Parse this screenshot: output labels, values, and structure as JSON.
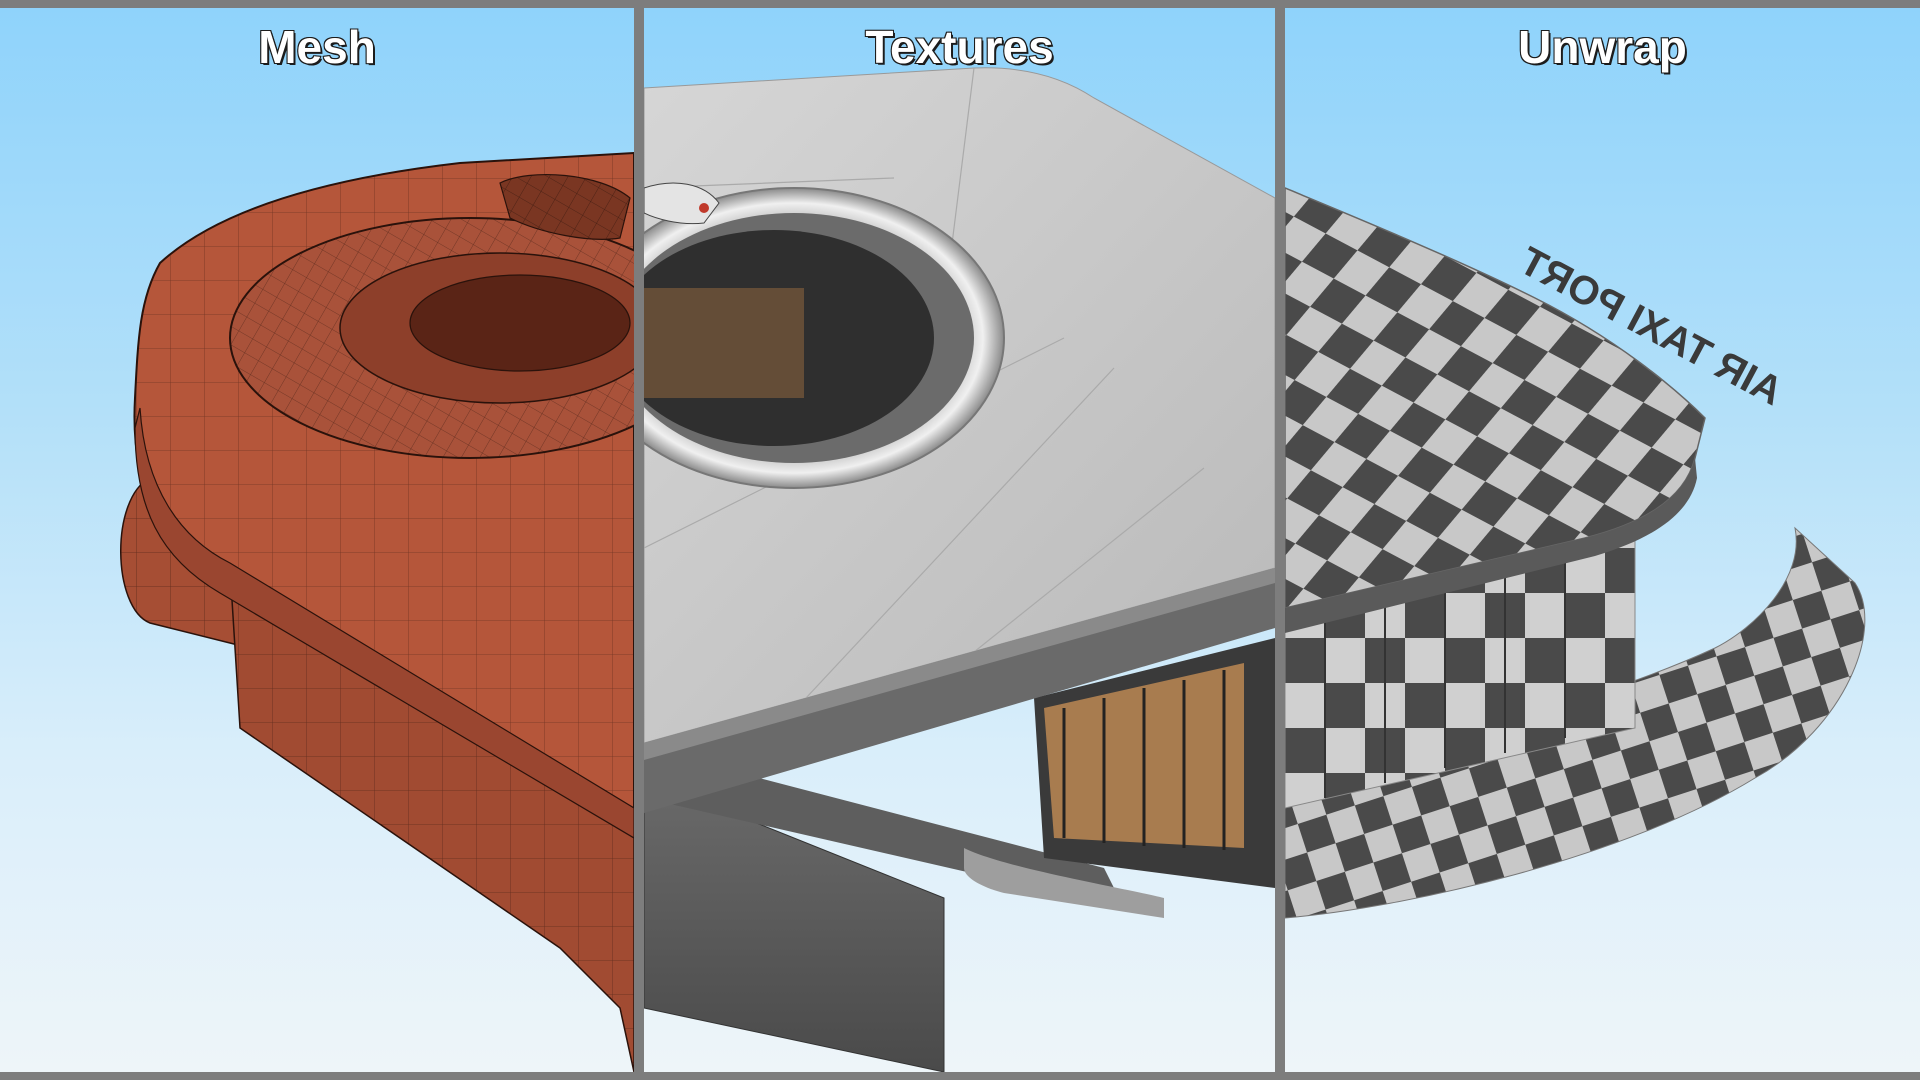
{
  "panels": [
    {
      "id": "mesh",
      "title": "Mesh"
    },
    {
      "id": "textures",
      "title": "Textures"
    },
    {
      "id": "unwrap",
      "title": "Unwrap"
    }
  ],
  "sign_text": "AIR TAXI PORT",
  "colors": {
    "frame": "#7d7d7d",
    "sky_top": "#8fd3fb",
    "sky_bottom": "#eef5f9",
    "mesh_fill": "#b5563a",
    "mesh_wire": "#2a120b",
    "texture_roof": "#c9c9c9",
    "texture_wall": "#5a5a5a",
    "checker_dark": "#4a4a4a",
    "checker_light": "#c8c8c8"
  }
}
